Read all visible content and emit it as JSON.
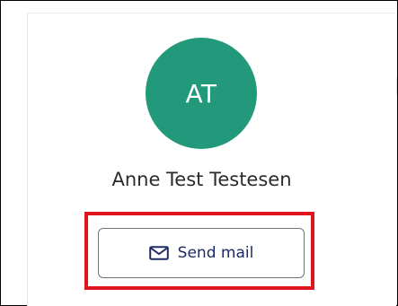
{
  "profile": {
    "initials": "AT",
    "name": "Anne Test Testesen"
  },
  "actions": {
    "send_mail_label": "Send mail",
    "send_mail_icon": "mail-icon"
  },
  "colors": {
    "avatar_bg": "#22997a",
    "accent": "#1f2a66",
    "highlight": "#e0141e"
  }
}
